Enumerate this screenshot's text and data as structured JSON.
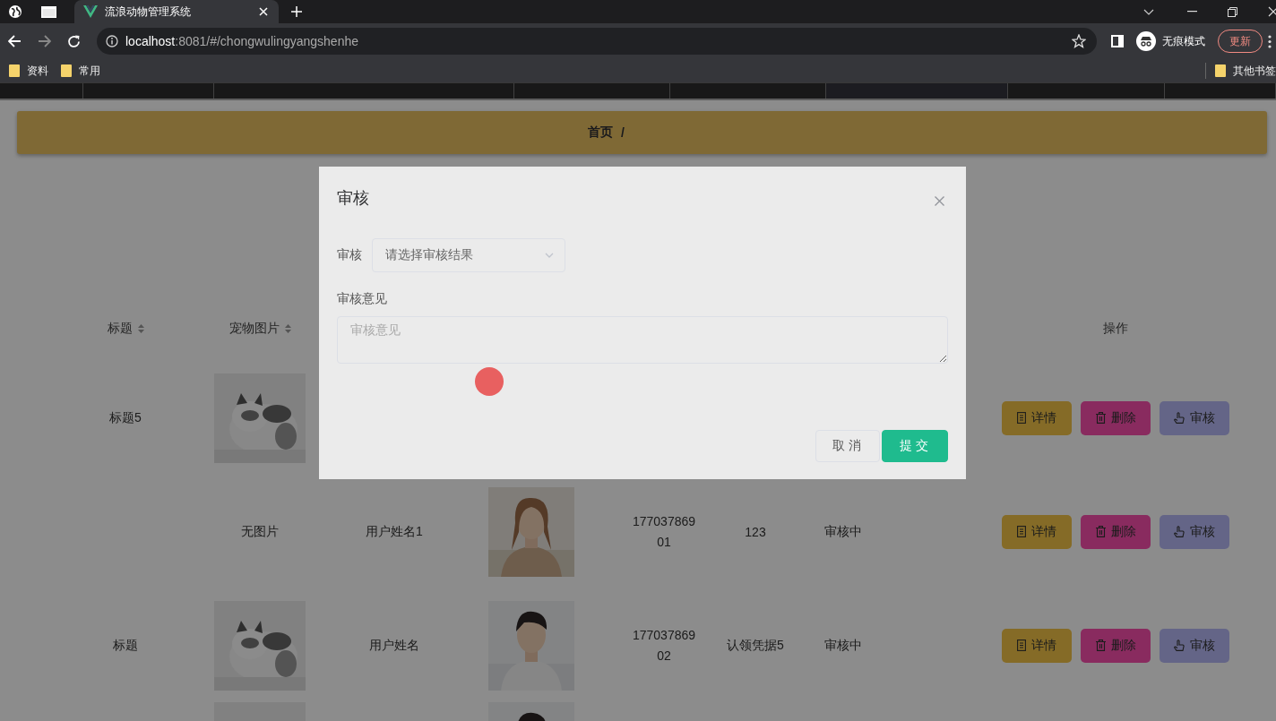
{
  "browser": {
    "tabs": [
      {
        "title": "流浪动物管理系统",
        "selected": true
      }
    ],
    "url_host": "localhost",
    "url_path": ":8081/#/chongwulingyangshenhe",
    "incognito_label": "无痕模式",
    "update_button": "更新",
    "bookmarks": [
      "资料",
      "常用"
    ],
    "other_bookmarks": "其他书签"
  },
  "breadcrumb": {
    "items": [
      "首页"
    ],
    "separator": "/"
  },
  "table": {
    "headers": [
      {
        "label": "标题",
        "sortable": true
      },
      {
        "label": "宠物图片",
        "sortable": true
      },
      {
        "label": "操作",
        "sortable": false
      }
    ],
    "rows": [
      {
        "title": "标题5",
        "pet_image": {
          "kind": "picture"
        },
        "actions": [
          {
            "kind": "detail",
            "label": "详情"
          },
          {
            "kind": "delete",
            "label": "删除"
          },
          {
            "kind": "review",
            "label": "审核"
          }
        ]
      },
      {
        "pet_image": {
          "kind": "text",
          "text": "无图片"
        },
        "user_name": "用户姓名1",
        "avatar": {
          "kind": "picture"
        },
        "phone": "17703786901",
        "claim_proof": "123",
        "status": "审核中",
        "actions": [
          {
            "kind": "detail",
            "label": "详情"
          },
          {
            "kind": "delete",
            "label": "删除"
          },
          {
            "kind": "review",
            "label": "审核"
          }
        ]
      },
      {
        "title": "标题",
        "pet_image": {
          "kind": "picture"
        },
        "user_name": "用户姓名",
        "avatar": {
          "kind": "picture"
        },
        "phone": "17703786902",
        "claim_proof": "认领凭据5",
        "status": "审核中",
        "actions": [
          {
            "kind": "detail",
            "label": "详情"
          },
          {
            "kind": "delete",
            "label": "删除"
          },
          {
            "kind": "review",
            "label": "审核"
          }
        ]
      },
      {
        "pet_image": {
          "kind": "picture"
        },
        "avatar": {
          "kind": "picture"
        }
      }
    ]
  },
  "dialog": {
    "title": "审核",
    "fields": [
      {
        "kind": "select",
        "label": "审核",
        "placeholder": "请选择审核结果"
      },
      {
        "kind": "textarea",
        "label": "审核意见",
        "placeholder": "审核意见"
      }
    ],
    "buttons": [
      {
        "kind": "cancel",
        "label": "取消"
      },
      {
        "kind": "submit",
        "label": "提交"
      }
    ]
  }
}
